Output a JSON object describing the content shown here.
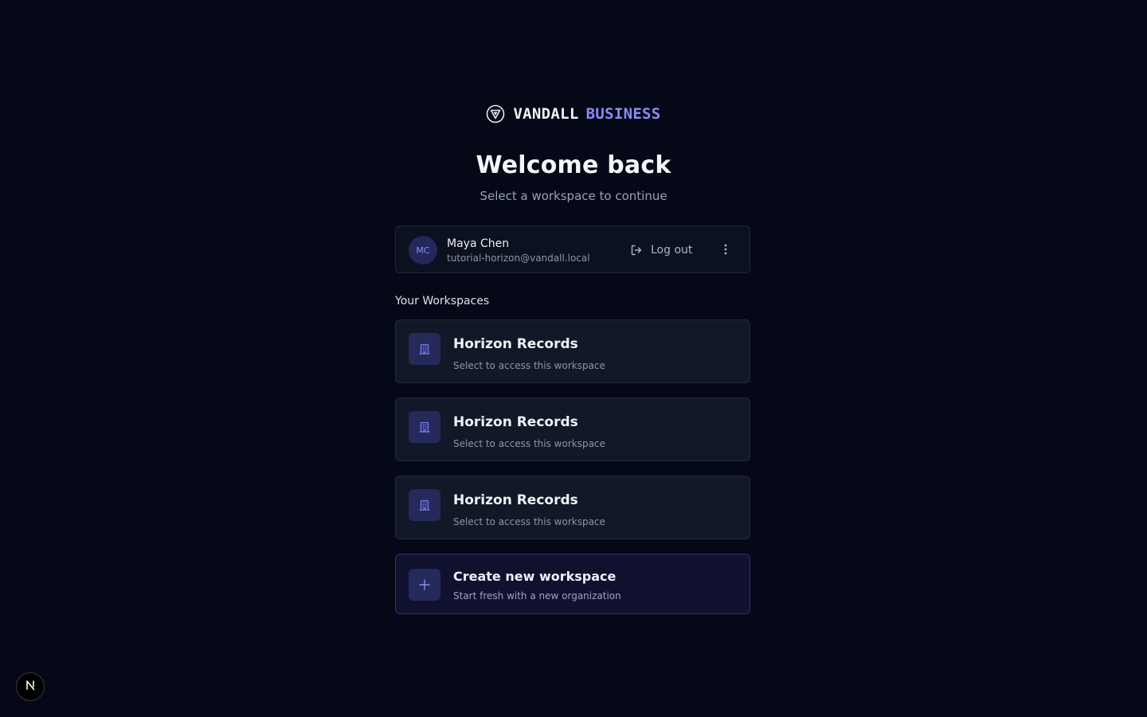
{
  "brand": {
    "name": "VANDALL",
    "tier": "BUSINESS",
    "accent_color": "#8b8cf6"
  },
  "header": {
    "title": "Welcome back",
    "subtitle": "Select a workspace to continue"
  },
  "user": {
    "initials": "MC",
    "name": "Maya Chen",
    "email": "tutorial-horizon@vandall.local",
    "logout_label": "Log out",
    "logout_icon": "logout-icon",
    "more_icon": "more-vertical-icon"
  },
  "workspaces": {
    "section_label": "Your Workspaces",
    "items": [
      {
        "name": "Horizon Records",
        "description": "Select to access this workspace",
        "icon": "building-icon"
      },
      {
        "name": "Horizon Records",
        "description": "Select to access this workspace",
        "icon": "building-icon"
      },
      {
        "name": "Horizon Records",
        "description": "Select to access this workspace",
        "icon": "building-icon"
      }
    ]
  },
  "create": {
    "title": "Create new workspace",
    "description": "Start fresh with a new organization",
    "icon": "plus-icon"
  },
  "dev_badge": {
    "letter": "N"
  }
}
